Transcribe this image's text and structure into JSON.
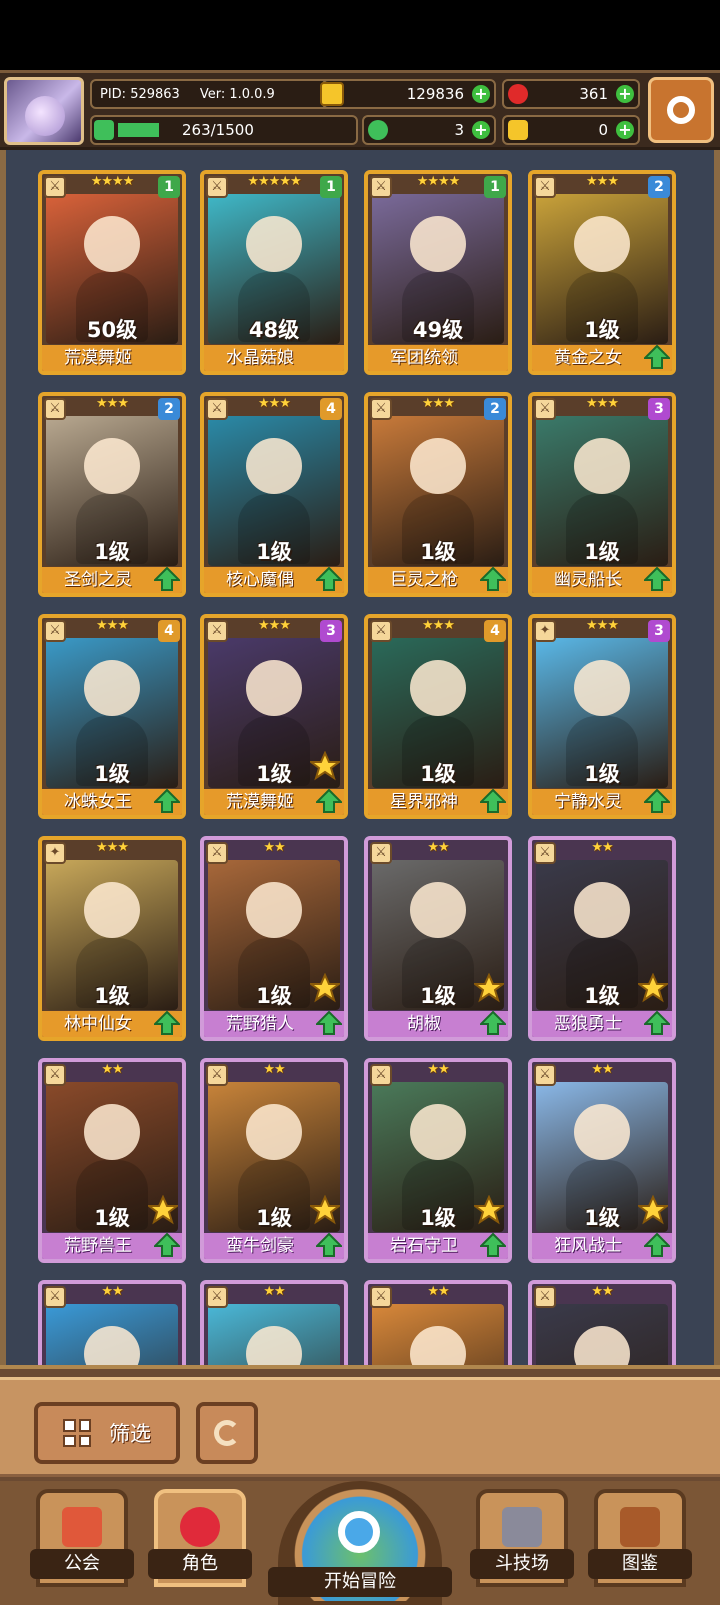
{
  "header": {
    "pid": "PID: 529863",
    "version": "Ver: 1.0.0.9",
    "gold": "129836",
    "gems": "361",
    "stamina": "263/1500",
    "stamina_fraction": 0.175,
    "clover": "3",
    "key": "0"
  },
  "cards": [
    {
      "level": "50级",
      "name": "荒漠舞姬",
      "stars": "★★★★",
      "grade": "1",
      "frame": "gold",
      "weapon": "⚔",
      "art": "#d9623a",
      "star_badge": false,
      "upgrade": false
    },
    {
      "level": "48级",
      "name": "水晶菇娘",
      "stars": "★★★★★",
      "grade": "1",
      "frame": "gold",
      "weapon": "⚔",
      "art": "#3fb8c8",
      "star_badge": false,
      "upgrade": false
    },
    {
      "level": "49级",
      "name": "军团统领",
      "stars": "★★★★",
      "grade": "1",
      "frame": "gold",
      "weapon": "⚔",
      "art": "#7a6a9a",
      "star_badge": false,
      "upgrade": false
    },
    {
      "level": "1级",
      "name": "黄金之女",
      "stars": "★★★",
      "grade": "2",
      "frame": "gold",
      "weapon": "⚔",
      "art": "#c9a23a",
      "star_badge": false,
      "upgrade": true
    },
    {
      "level": "1级",
      "name": "圣剑之灵",
      "stars": "★★★",
      "grade": "2",
      "frame": "gold",
      "weapon": "⚔",
      "art": "#b8a890",
      "star_badge": false,
      "upgrade": true
    },
    {
      "level": "1级",
      "name": "核心魔偶",
      "stars": "★★★",
      "grade": "4",
      "frame": "gold",
      "weapon": "⚔",
      "art": "#2a8aa8",
      "star_badge": false,
      "upgrade": true
    },
    {
      "level": "1级",
      "name": "巨灵之枪",
      "stars": "★★★",
      "grade": "2",
      "frame": "gold",
      "weapon": "⚔",
      "art": "#c87a3a",
      "star_badge": false,
      "upgrade": true
    },
    {
      "level": "1级",
      "name": "幽灵船长",
      "stars": "★★★",
      "grade": "3",
      "frame": "gold",
      "weapon": "⚔",
      "art": "#3a7a6a",
      "star_badge": false,
      "upgrade": true
    },
    {
      "level": "1级",
      "name": "冰蛛女王",
      "stars": "★★★",
      "grade": "4",
      "frame": "gold",
      "weapon": "⚔",
      "art": "#3a9ac8",
      "star_badge": false,
      "upgrade": true
    },
    {
      "level": "1级",
      "name": "荒漠舞姬",
      "stars": "★★★",
      "grade": "3",
      "frame": "gold",
      "weapon": "⚔",
      "art": "#4a3a6a",
      "star_badge": true,
      "upgrade": true
    },
    {
      "level": "1级",
      "name": "星界邪神",
      "stars": "★★★",
      "grade": "4",
      "frame": "gold",
      "weapon": "⚔",
      "art": "#2a6a5a",
      "star_badge": false,
      "upgrade": true
    },
    {
      "level": "1级",
      "name": "宁静水灵",
      "stars": "★★★",
      "grade": "3",
      "frame": "gold",
      "weapon": "✦",
      "art": "#5ab8e8",
      "star_badge": false,
      "upgrade": true
    },
    {
      "level": "1级",
      "name": "林中仙女",
      "stars": "★★★",
      "grade": "",
      "frame": "gold",
      "weapon": "✦",
      "art": "#c8a85a",
      "star_badge": false,
      "upgrade": true
    },
    {
      "level": "1级",
      "name": "荒野猎人",
      "stars": "★★",
      "grade": "",
      "frame": "purple",
      "weapon": "⚔",
      "art": "#a8683a",
      "star_badge": true,
      "upgrade": true
    },
    {
      "level": "1级",
      "name": "胡椒",
      "stars": "★★",
      "grade": "",
      "frame": "purple",
      "weapon": "⚔",
      "art": "#6a6a6a",
      "star_badge": true,
      "upgrade": true
    },
    {
      "level": "1级",
      "name": "恶狼勇士",
      "stars": "★★",
      "grade": "",
      "frame": "purple",
      "weapon": "⚔",
      "art": "#3a3a4a",
      "star_badge": true,
      "upgrade": true
    },
    {
      "level": "1级",
      "name": "荒野兽王",
      "stars": "★★",
      "grade": "",
      "frame": "purple",
      "weapon": "⚔",
      "art": "#8a4a2a",
      "star_badge": true,
      "upgrade": true
    },
    {
      "level": "1级",
      "name": "蛮牛剑豪",
      "stars": "★★",
      "grade": "",
      "frame": "purple",
      "weapon": "⚔",
      "art": "#c8843a",
      "star_badge": true,
      "upgrade": true
    },
    {
      "level": "1级",
      "name": "岩石守卫",
      "stars": "★★",
      "grade": "",
      "frame": "purple",
      "weapon": "⚔",
      "art": "#4a7a5a",
      "star_badge": true,
      "upgrade": true
    },
    {
      "level": "1级",
      "name": "狂风战士",
      "stars": "★★",
      "grade": "",
      "frame": "purple",
      "weapon": "⚔",
      "art": "#8ab8e8",
      "star_badge": true,
      "upgrade": true
    },
    {
      "level": "",
      "name": "",
      "stars": "★★",
      "grade": "",
      "frame": "purple",
      "weapon": "⚔",
      "art": "#3a9ad8",
      "star_badge": false,
      "upgrade": false
    },
    {
      "level": "",
      "name": "",
      "stars": "★★",
      "grade": "",
      "frame": "purple",
      "weapon": "⚔",
      "art": "#4ab8d8",
      "star_badge": false,
      "upgrade": false
    },
    {
      "level": "",
      "name": "",
      "stars": "★★",
      "grade": "",
      "frame": "purple",
      "weapon": "⚔",
      "art": "#d8883a",
      "star_badge": false,
      "upgrade": false
    },
    {
      "level": "",
      "name": "",
      "stars": "★★",
      "grade": "",
      "frame": "purple",
      "weapon": "⚔",
      "art": "#3a3a4a",
      "star_badge": false,
      "upgrade": false
    }
  ],
  "grade_colors": {
    "1": "#3fa84a",
    "2": "#3a8ad8",
    "3": "#b04ad0",
    "4": "#e09a2a"
  },
  "controls": {
    "filter_label": "筛选",
    "filter_icon": "grid-icon",
    "reset_icon": "refresh-icon"
  },
  "nav": [
    {
      "label": "公会",
      "icon": "guild-icon"
    },
    {
      "label": "角色",
      "icon": "character-icon"
    },
    {
      "label": "开始冒险",
      "icon": "magnifier-icon"
    },
    {
      "label": "斗技场",
      "icon": "swords-icon"
    },
    {
      "label": "图鉴",
      "icon": "book-icon"
    }
  ]
}
